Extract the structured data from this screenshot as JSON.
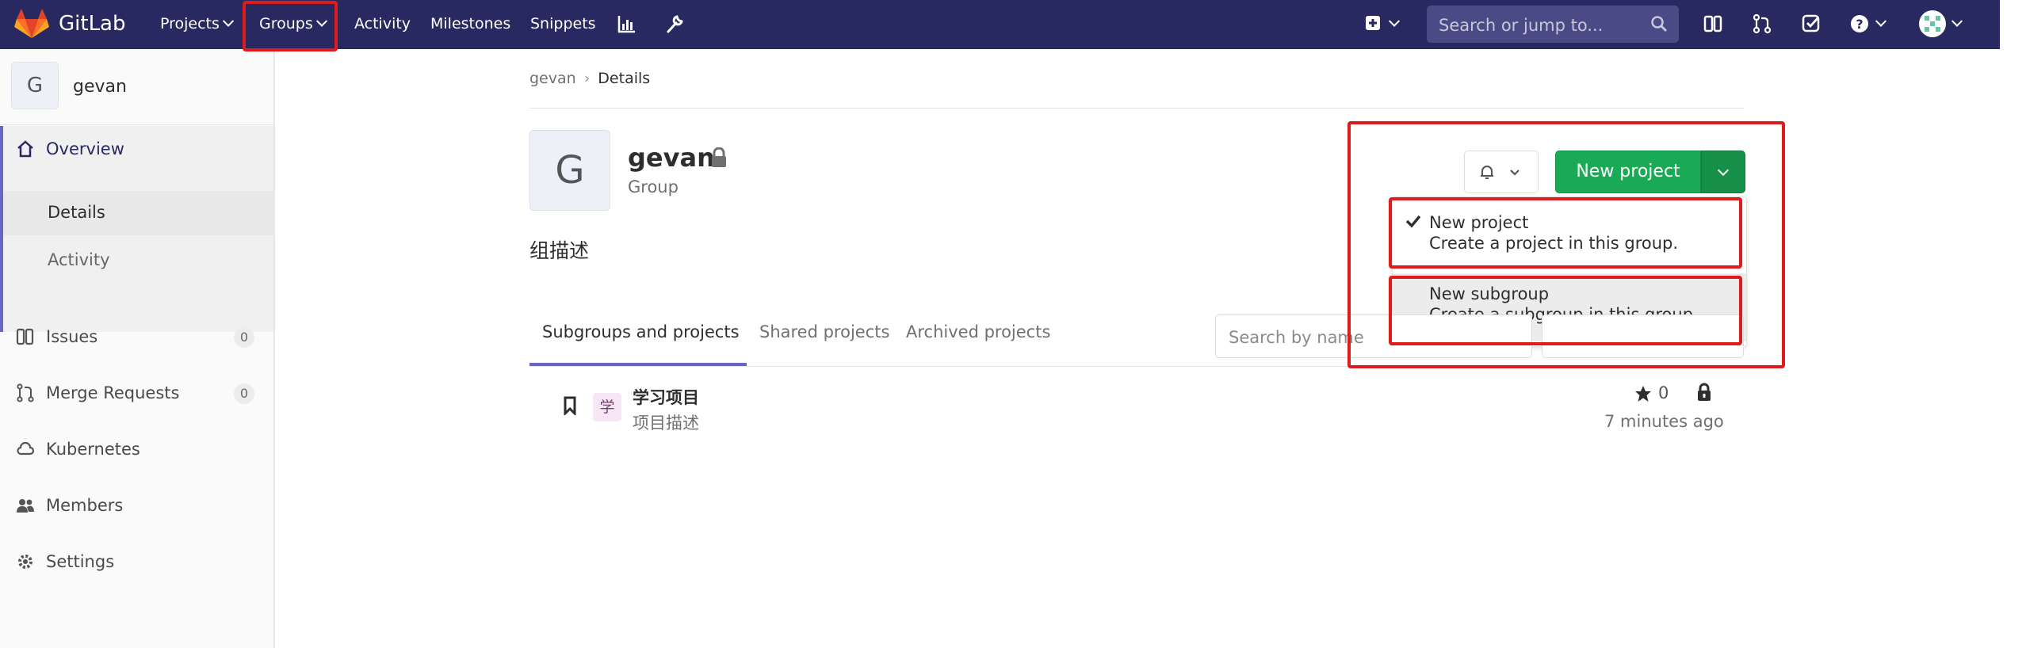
{
  "navbar": {
    "brand": "GitLab",
    "items": [
      {
        "label": "Projects"
      },
      {
        "label": "Groups"
      },
      {
        "label": "Activity"
      },
      {
        "label": "Milestones"
      },
      {
        "label": "Snippets"
      }
    ],
    "search_placeholder": "Search or jump to...",
    "icons": [
      "chart-icon",
      "wrench-icon",
      "plus-square-icon",
      "issues-icon",
      "merge-request-icon",
      "todo-icon",
      "help-icon",
      "user-avatar"
    ]
  },
  "sidebar": {
    "avatar_letter": "G",
    "title": "gevan",
    "overview": {
      "label": "Overview"
    },
    "overview_subitems": [
      {
        "label": "Details",
        "active": true
      },
      {
        "label": "Activity",
        "active": false
      }
    ],
    "items": [
      {
        "label": "Issues",
        "count": "0"
      },
      {
        "label": "Merge Requests",
        "count": "0"
      },
      {
        "label": "Kubernetes"
      },
      {
        "label": "Members"
      },
      {
        "label": "Settings"
      }
    ]
  },
  "breadcrumb": {
    "parent": "gevan",
    "separator": "›",
    "current": "Details"
  },
  "group": {
    "avatar_letter": "G",
    "name": "gevan",
    "type": "Group",
    "description": "组描述"
  },
  "actions": {
    "new_project_label": "New project",
    "dropdown": [
      {
        "title": "New project",
        "desc": "Create a project in this group.",
        "checked": true
      },
      {
        "title": "New subgroup",
        "desc": "Create a subgroup in this group.",
        "checked": false
      }
    ]
  },
  "tabs": [
    {
      "label": "Subgroups and projects",
      "active": true
    },
    {
      "label": "Shared projects",
      "active": false
    },
    {
      "label": "Archived projects",
      "active": false
    }
  ],
  "filter": {
    "placeholder": "Search by name"
  },
  "projects": [
    {
      "avatar": "学",
      "name": "学习项目",
      "desc": "项目描述",
      "stars": "0",
      "updated": "7 minutes ago"
    }
  ],
  "colors": {
    "navbar": "#292961",
    "accent": "#6666c4",
    "success": "#1aaa55",
    "highlight": "#e01b1b"
  }
}
